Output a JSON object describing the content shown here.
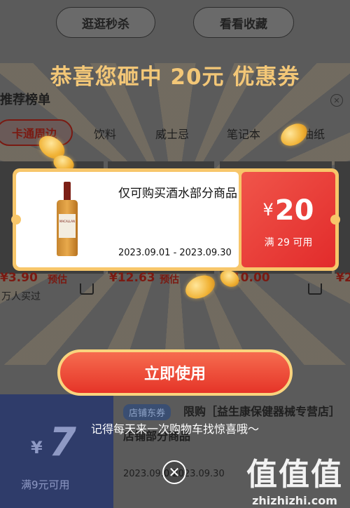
{
  "background": {
    "top_buttons": [
      "逛逛秒杀",
      "看看收藏"
    ],
    "section_title": "推荐榜单",
    "close_icon": "close-icon",
    "tabs": [
      "卡通周边",
      "饮料",
      "威士忌",
      "笔记本",
      "油纸"
    ],
    "prices": [
      "¥3.90",
      "¥12.63",
      "¥10.00",
      "¥2"
    ],
    "presale_tags": [
      "预估",
      "预估"
    ],
    "sold_text": "万人买过",
    "store_coupon": {
      "amount_symbol": "¥",
      "amount": "7",
      "condition": "满9元可用",
      "tag": "店铺东券",
      "title": "限购［益生康保健器械专营店］",
      "subtitle": "店铺部分商品",
      "date": "2023.09.0 2023.09.30"
    }
  },
  "modal": {
    "headline": "恭喜您砸中 20元 优惠券",
    "coupon": {
      "product_icon": "whisky-bottle-image",
      "bottle_label": "MACALLAN",
      "description": "仅可购买酒水部分商品",
      "validity": "2023.09.01 - 2023.09.30",
      "currency": "¥",
      "value": "20",
      "condition": "满 29 可用"
    },
    "use_button": "立即使用",
    "reminder": "记得每天来一次购物车找惊喜哦～",
    "close_icon": "close-circle-icon"
  },
  "watermark": {
    "logo": "值值值",
    "url": "zhizhizhi.com"
  },
  "colors": {
    "overlay": "#5b5b5b",
    "headline": "#f3c777",
    "coupon_border": "#f7c66a",
    "coupon_red": "#e22b2b",
    "button_red": "#e53428"
  }
}
